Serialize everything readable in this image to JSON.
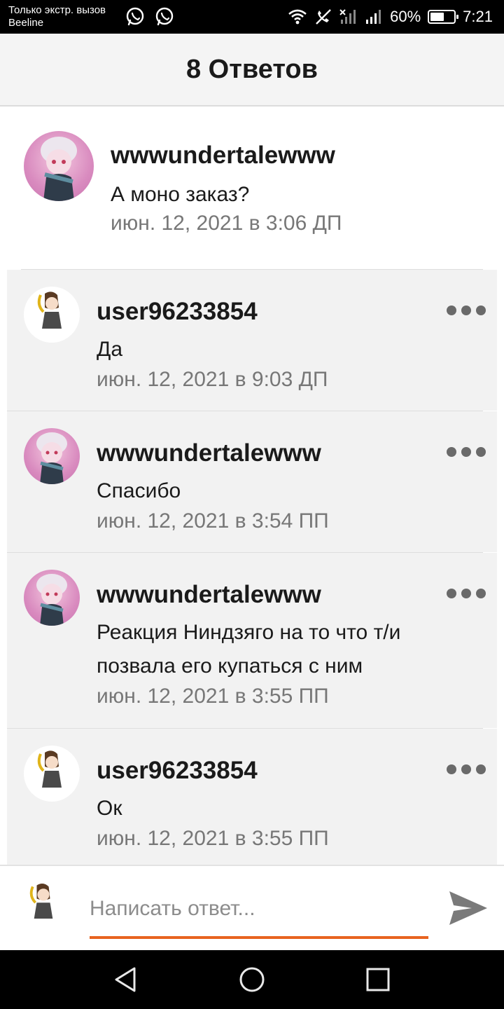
{
  "status_bar": {
    "carrier_line1": "Только экстр. вызов",
    "carrier_line2": "Beeline",
    "battery_percent": "60%",
    "battery_level": 0.6,
    "time": "7:21"
  },
  "header": {
    "title": "8 Ответов"
  },
  "post": {
    "username": "wwwundertalewww",
    "text": "А моно заказ?",
    "timestamp": "июн. 12, 2021 в 3:06 ДП"
  },
  "replies": [
    {
      "username": "user96233854",
      "text": "Да",
      "timestamp": "июн. 12, 2021 в 9:03 ДП"
    },
    {
      "username": "wwwundertalewww",
      "text": "Спасибо",
      "timestamp": "июн. 12, 2021 в 3:54 ПП"
    },
    {
      "username": "wwwundertalewww",
      "text": "Реакция Ниндзяго на то что т/и позвала его купаться с ним",
      "timestamp": "июн. 12, 2021 в 3:55 ПП"
    },
    {
      "username": "user96233854",
      "text": "Ок",
      "timestamp": "июн. 12, 2021 в 3:55 ПП"
    }
  ],
  "composer": {
    "placeholder": "Написать ответ..."
  },
  "colors": {
    "accent": "#e8631f",
    "reply_background": "#f2f2f2",
    "header_background": "#f4f4f4"
  }
}
